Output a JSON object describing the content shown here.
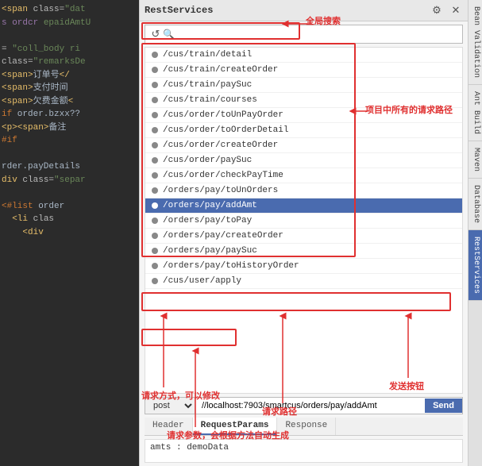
{
  "app": {
    "title": "RestServices",
    "gear_icon": "⚙",
    "refresh_icon": "↺",
    "search_placeholder": ""
  },
  "header": {
    "title": "RestServices"
  },
  "annotations": {
    "global_search": "全局搜索",
    "all_routes": "项目中所有的请求路径",
    "request_method": "请求方式，可以修改",
    "request_path": "请求路径",
    "send_button": "发送按钮",
    "request_params": "请求参数，会根据方法自动生成"
  },
  "routes": [
    {
      "path": "/cus/train/detail",
      "selected": false
    },
    {
      "path": "/cus/train/createOrder",
      "selected": false
    },
    {
      "path": "/cus/train/paySuc",
      "selected": false
    },
    {
      "path": "/cus/train/courses",
      "selected": false
    },
    {
      "path": "/cus/order/toUnPayOrder",
      "selected": false
    },
    {
      "path": "/cus/order/toOrderDetail",
      "selected": false
    },
    {
      "path": "/cus/order/createOrder",
      "selected": false
    },
    {
      "path": "/cus/order/paySuc",
      "selected": false
    },
    {
      "path": "/cus/order/checkPayTime",
      "selected": false
    },
    {
      "path": "/orders/pay/toUnOrders",
      "selected": false
    },
    {
      "path": "/orders/pay/addAmt",
      "selected": true
    },
    {
      "path": "/orders/pay/toPay",
      "selected": false
    },
    {
      "path": "/orders/pay/createOrder",
      "selected": false
    },
    {
      "path": "/orders/pay/paySuc",
      "selected": false
    },
    {
      "path": "/orders/pay/toHistoryOrder",
      "selected": false
    },
    {
      "path": "/cus/user/apply",
      "selected": false
    }
  ],
  "request": {
    "method": "post",
    "url": "//localhost:7903/smartcus/orders/pay/addAmt",
    "send_label": "Send"
  },
  "tabs": [
    {
      "label": "Header",
      "active": false
    },
    {
      "label": "RequestParams",
      "active": true
    },
    {
      "label": "Response",
      "active": false
    }
  ],
  "params": {
    "value": "amts : demoData"
  },
  "side_tabs": [
    {
      "label": "Bean Validation",
      "active": false
    },
    {
      "label": "Ant Build",
      "active": false
    },
    {
      "label": "Maven",
      "active": false
    },
    {
      "label": "Database",
      "active": false
    },
    {
      "label": "RestServices",
      "active": true
    }
  ],
  "code_lines": [
    {
      "text": "span class=\"dat"
    },
    {
      "text": "s ordcr epaidAmtU"
    },
    {
      "text": ""
    },
    {
      "text": "= \"coll_body ri"
    },
    {
      "text": "class=\"remarksDe"
    },
    {
      "text": "<span>订单号</"
    },
    {
      "text": "<span>支付时间"
    },
    {
      "text": "<span>欠费金额<"
    },
    {
      "text": "if order.bzxx??"
    },
    {
      "text": "<p><span>备注"
    },
    {
      "text": "#if"
    },
    {
      "text": ""
    },
    {
      "text": "rder.payDetails"
    },
    {
      "text": "div class=\"separ"
    },
    {
      "text": ""
    },
    {
      "text": "<#list order"
    },
    {
      "text": "  <li clas"
    },
    {
      "text": "    <div"
    }
  ]
}
